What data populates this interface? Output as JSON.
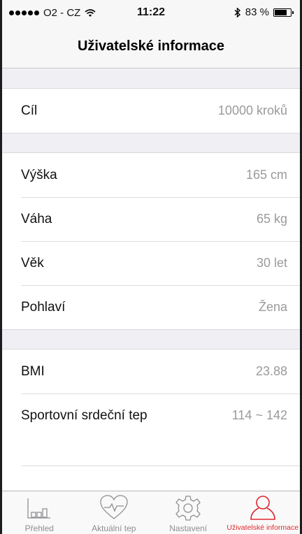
{
  "status_bar": {
    "carrier": "O2 - CZ",
    "time": "11:22",
    "battery": "83 %",
    "battery_level": 0.83
  },
  "nav": {
    "title": "Uživatelské informace"
  },
  "groups": {
    "goal": [
      {
        "label": "Cíl",
        "value": "10000  kroků"
      }
    ],
    "body": [
      {
        "label": "Výška",
        "value": "165 cm"
      },
      {
        "label": "Váha",
        "value": "65 kg"
      },
      {
        "label": "Věk",
        "value": "30  let"
      },
      {
        "label": "Pohlaví",
        "value": "Žena"
      }
    ],
    "stats": [
      {
        "label": "BMI",
        "value": "23.88"
      },
      {
        "label": "Sportovní srdeční tep",
        "value": "114 ~ 142"
      }
    ]
  },
  "tabs": [
    {
      "label": "Přehled",
      "icon": "bar-chart-icon",
      "active": false
    },
    {
      "label": "Aktuální tep",
      "icon": "heart-pulse-icon",
      "active": false
    },
    {
      "label": "Nastavení",
      "icon": "gear-icon",
      "active": false
    },
    {
      "label": "Uživatelské informace",
      "icon": "user-icon",
      "active": true
    }
  ],
  "colors": {
    "accent": "#e0282e",
    "muted": "#8e8e93",
    "background": "#efeff4"
  }
}
